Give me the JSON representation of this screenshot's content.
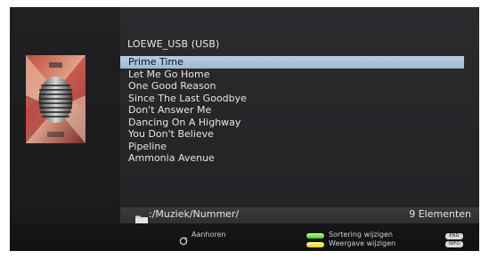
{
  "source": {
    "title": "LOEWE_USB (USB)"
  },
  "tracks": [
    "Prime Time",
    "Let Me Go Home",
    "One Good Reason",
    "Since The Last Goodbye",
    "Don't Answer Me",
    "Dancing On A Highway",
    "You Don't Believe",
    "Pipeline",
    "Ammonia Avenue"
  ],
  "selected_index": 0,
  "path": {
    "text": ":/Muziek/Nummer/",
    "icon": "folder-icon"
  },
  "count": {
    "text": "9 Elementen"
  },
  "footer": {
    "listen_label": "Aanhoren",
    "listen_icon": "playback-icon",
    "sort_label": "Sortering wijzigen",
    "view_label": "Weergave wijzigen",
    "end_key": "END",
    "info_key": "INFO"
  },
  "colors": {
    "selection": "#a8c1dc",
    "green_key": "#4fc52a",
    "yellow_key": "#e2cc22"
  }
}
